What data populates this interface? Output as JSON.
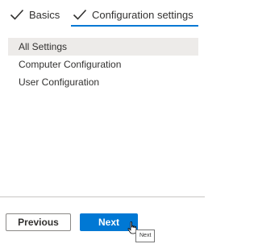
{
  "tabs": [
    {
      "label": "Basics",
      "icon": "checkmark-icon",
      "completed": true
    },
    {
      "label": "Configuration settings",
      "icon": "checkmark-icon",
      "completed": true,
      "active": true
    }
  ],
  "menu": {
    "items": [
      {
        "label": "All Settings",
        "selected": true
      },
      {
        "label": "Computer Configuration",
        "selected": false
      },
      {
        "label": "User Configuration",
        "selected": false
      }
    ]
  },
  "footer": {
    "previous_label": "Previous",
    "next_label": "Next",
    "tooltip": "Next"
  },
  "colors": {
    "accent": "#0078d4",
    "selected_bg": "#edebe9",
    "text": "#323130"
  }
}
